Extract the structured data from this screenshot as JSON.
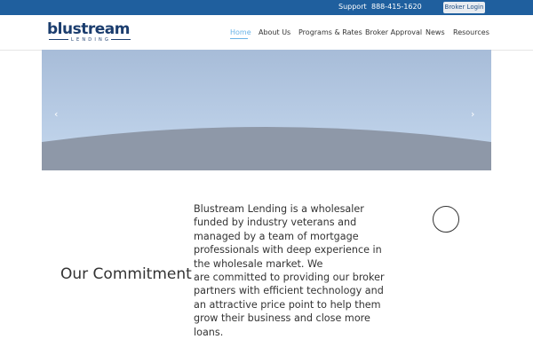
{
  "topbar": {
    "support_label": "Support",
    "phone": "888-415-1620",
    "login_label": "Broker Login"
  },
  "logo": {
    "word": "blustream",
    "sub": "LENDING"
  },
  "nav": {
    "items": [
      {
        "label": "Home",
        "active": true
      },
      {
        "label": "About Us"
      },
      {
        "label": "Programs & Rates"
      },
      {
        "label": "Broker Approval"
      },
      {
        "label": "News"
      },
      {
        "label": "Resources"
      }
    ]
  },
  "slider": {
    "prev_icon": "chevron-left-icon",
    "prev_glyph": "‹",
    "next_icon": "chevron-right-icon",
    "next_glyph": "›"
  },
  "commitment": {
    "heading": "Our Commitment",
    "lines": [
      "Blustream Lending is a wholesaler",
      "funded by industry veterans and",
      "managed by a team of mortgage",
      "professionals with deep experience in",
      "the wholesale market. We",
      "are committed to providing our broker",
      "partners with efficient technology and",
      "an attractive price point to help them",
      "grow their business and close more",
      "loans."
    ]
  },
  "colors": {
    "topbar": "#1f5f9e",
    "brand": "#1b3d6e",
    "active_nav": "#69b3e7",
    "text": "#333333"
  }
}
